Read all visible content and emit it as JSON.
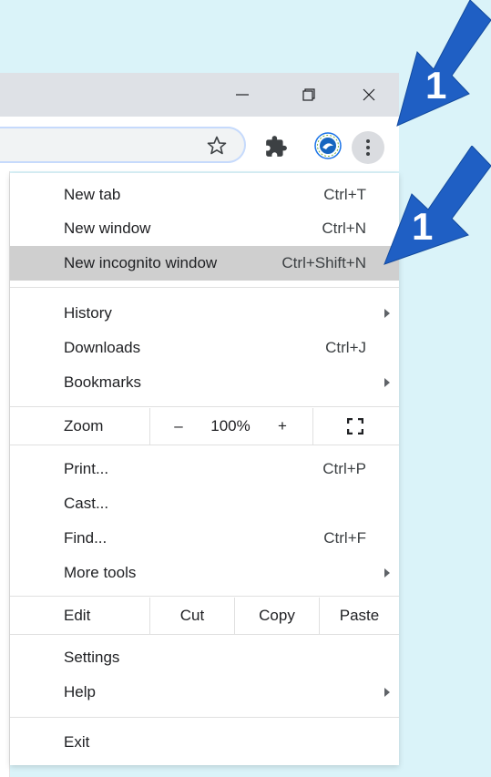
{
  "menu": {
    "new_tab": {
      "label": "New tab",
      "shortcut": "Ctrl+T"
    },
    "new_window": {
      "label": "New window",
      "shortcut": "Ctrl+N"
    },
    "new_incognito": {
      "label": "New incognito window",
      "shortcut": "Ctrl+Shift+N"
    },
    "history": {
      "label": "History"
    },
    "downloads": {
      "label": "Downloads",
      "shortcut": "Ctrl+J"
    },
    "bookmarks": {
      "label": "Bookmarks"
    },
    "zoom": {
      "label": "Zoom",
      "minus": "–",
      "level": "100%",
      "plus": "+"
    },
    "print": {
      "label": "Print...",
      "shortcut": "Ctrl+P"
    },
    "cast": {
      "label": "Cast..."
    },
    "find": {
      "label": "Find...",
      "shortcut": "Ctrl+F"
    },
    "more_tools": {
      "label": "More tools"
    },
    "edit": {
      "label": "Edit",
      "cut": "Cut",
      "copy": "Copy",
      "paste": "Paste"
    },
    "settings": {
      "label": "Settings"
    },
    "help": {
      "label": "Help"
    },
    "exit": {
      "label": "Exit"
    }
  },
  "annotations": {
    "step_top": "1",
    "step_menu": "1"
  },
  "colors": {
    "background": "#daf3f9",
    "arrow": "#1f5fc4",
    "highlight": "#cfcfcf",
    "titlebar": "#dee1e6"
  },
  "icons": [
    "minimize-icon",
    "restore-icon",
    "close-icon",
    "bookmark-star-icon",
    "extensions-puzzle-icon",
    "profile-avatar-icon",
    "more-vertical-icon",
    "fullscreen-icon"
  ]
}
